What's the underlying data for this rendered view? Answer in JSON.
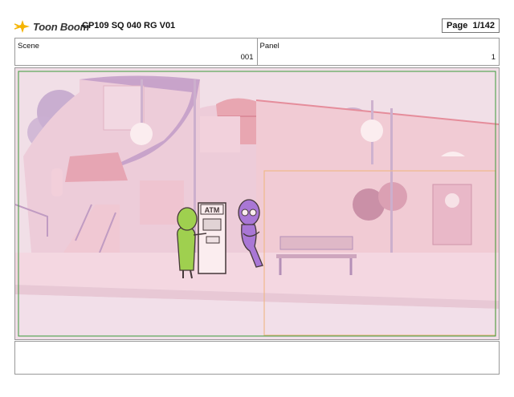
{
  "header": {
    "logo_text": "Toon Boom",
    "doc_title": "CP109 SQ 040 RG V01",
    "page_label": "Page",
    "page_value": "1/142"
  },
  "info": {
    "scene_label": "Scene",
    "scene_value": "001",
    "panel_label": "Panel",
    "panel_value": "1"
  },
  "panel": {
    "atm_sign": "ATM"
  },
  "colors": {
    "accent_logo": "#f5b400",
    "field_guide_green": "#3a9b3a",
    "camera_box_orange": "#f0b98c",
    "character_green": "#8fdc3c",
    "character_purple": "#9b6fe0"
  }
}
